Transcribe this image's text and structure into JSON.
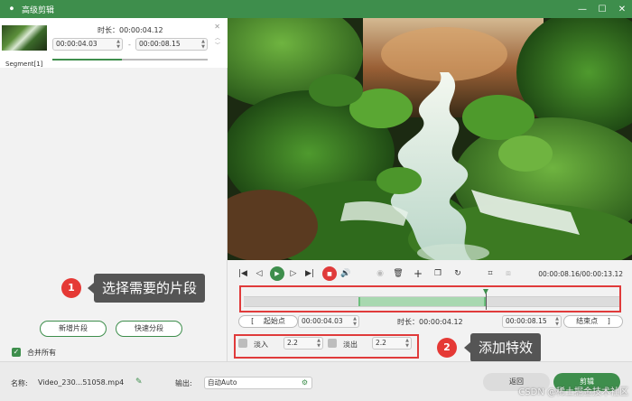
{
  "window": {
    "title": "高级剪辑",
    "logo_glyph": "ꔷ",
    "minimize_glyph": "—",
    "maximize_glyph": "☐",
    "close_glyph": "✕"
  },
  "segment": {
    "duration_label": "时长：00:00:04.12",
    "start": "00:00:04.03",
    "end": "00:00:08.15",
    "dash": "-",
    "name": "Segment[1]",
    "close_glyph": "✕",
    "up_glyph": "︿",
    "down_glyph": "﹀",
    "progress": 0.45
  },
  "left_buttons": {
    "add_segment": "新增片段",
    "quick_split": "快速分段",
    "merge_all": "合并所有",
    "merge_checked": true,
    "check_glyph": "✓"
  },
  "player": {
    "timecode": "00:00:08.16/00:00:13.12",
    "icons": [
      "skip-start-icon",
      "prev-frame-icon",
      "play-icon",
      "next-frame-icon",
      "skip-end-icon",
      "stop-icon",
      "volume-icon",
      "loop-icon",
      "delete-icon",
      "add-icon",
      "copy-icon",
      "refresh-icon",
      "crop-icon",
      "fit-icon"
    ],
    "glyphs": {
      "skip_start": "|◀",
      "prev": "◁",
      "play": "▶",
      "next": "▷",
      "skip_end": "▶|",
      "stop": "■",
      "volume": "🔊",
      "loop": "◉",
      "delete": "🗑",
      "add": "+",
      "copy": "❐",
      "refresh": "↻",
      "crop": "⌗",
      "fit": "⧈"
    }
  },
  "timeline": {
    "selection_start": 0.305,
    "selection_end": 0.64,
    "playhead": 0.64
  },
  "range": {
    "start_label": "起始点",
    "start_glyph": "[",
    "start_value": "00:00:04.03",
    "duration": "时长：00:00:04.12",
    "end_value": "00:00:08.15",
    "end_label": "结束点",
    "end_glyph": "]",
    "spin_glyph": "▲▼"
  },
  "effects": {
    "fade_in_label": "淡入",
    "fade_in_value": "2.2",
    "fade_out_label": "淡出",
    "fade_out_value": "2.2"
  },
  "bottom": {
    "name_label": "名称:",
    "name_value": "Video_230...51058.mp4",
    "edit_glyph": "✎",
    "output_label": "输出:",
    "output_value": "自动Auto",
    "gear_glyph": "⚙",
    "back_button": "返回",
    "cut_button": "剪辑"
  },
  "callouts": [
    {
      "number": "1",
      "text": "选择需要的片段"
    },
    {
      "number": "2",
      "text": "添加特效"
    }
  ],
  "watermark": "CSDN @稀土掘金技术社区",
  "colors": {
    "brand_green": "#3e8e4c",
    "annotation_red": "#e03b3b",
    "callout_gray": "#555555",
    "selection_green": "#a8d8b0"
  }
}
